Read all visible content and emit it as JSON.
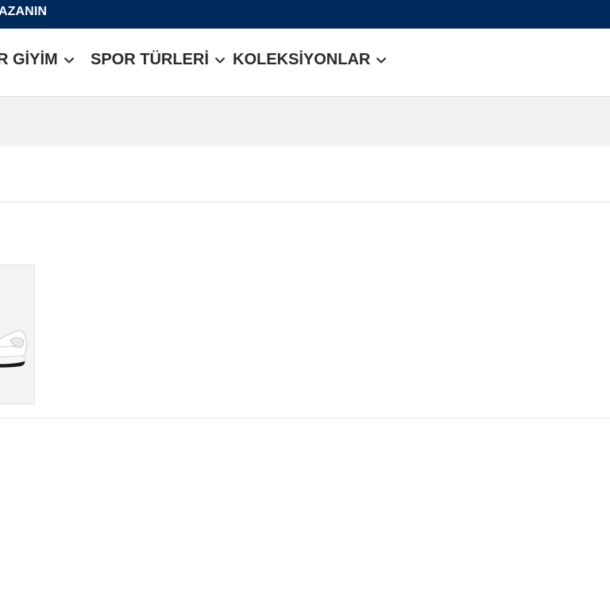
{
  "promo_bar": {
    "text": "AZANIN",
    "background": "#002a5c"
  },
  "nav": {
    "items": [
      {
        "label": "R GİYİM",
        "icon": "chevron-down-icon"
      },
      {
        "label": "SPOR TÜRLERİ",
        "icon": "chevron-down-icon"
      },
      {
        "label": "KOLEKSİYONLAR",
        "icon": "chevron-down-icon"
      }
    ]
  },
  "product": {
    "image_icon": "sneaker-image",
    "shoe_color": "#ffffff",
    "sole_accent": "#1a1a1a"
  }
}
